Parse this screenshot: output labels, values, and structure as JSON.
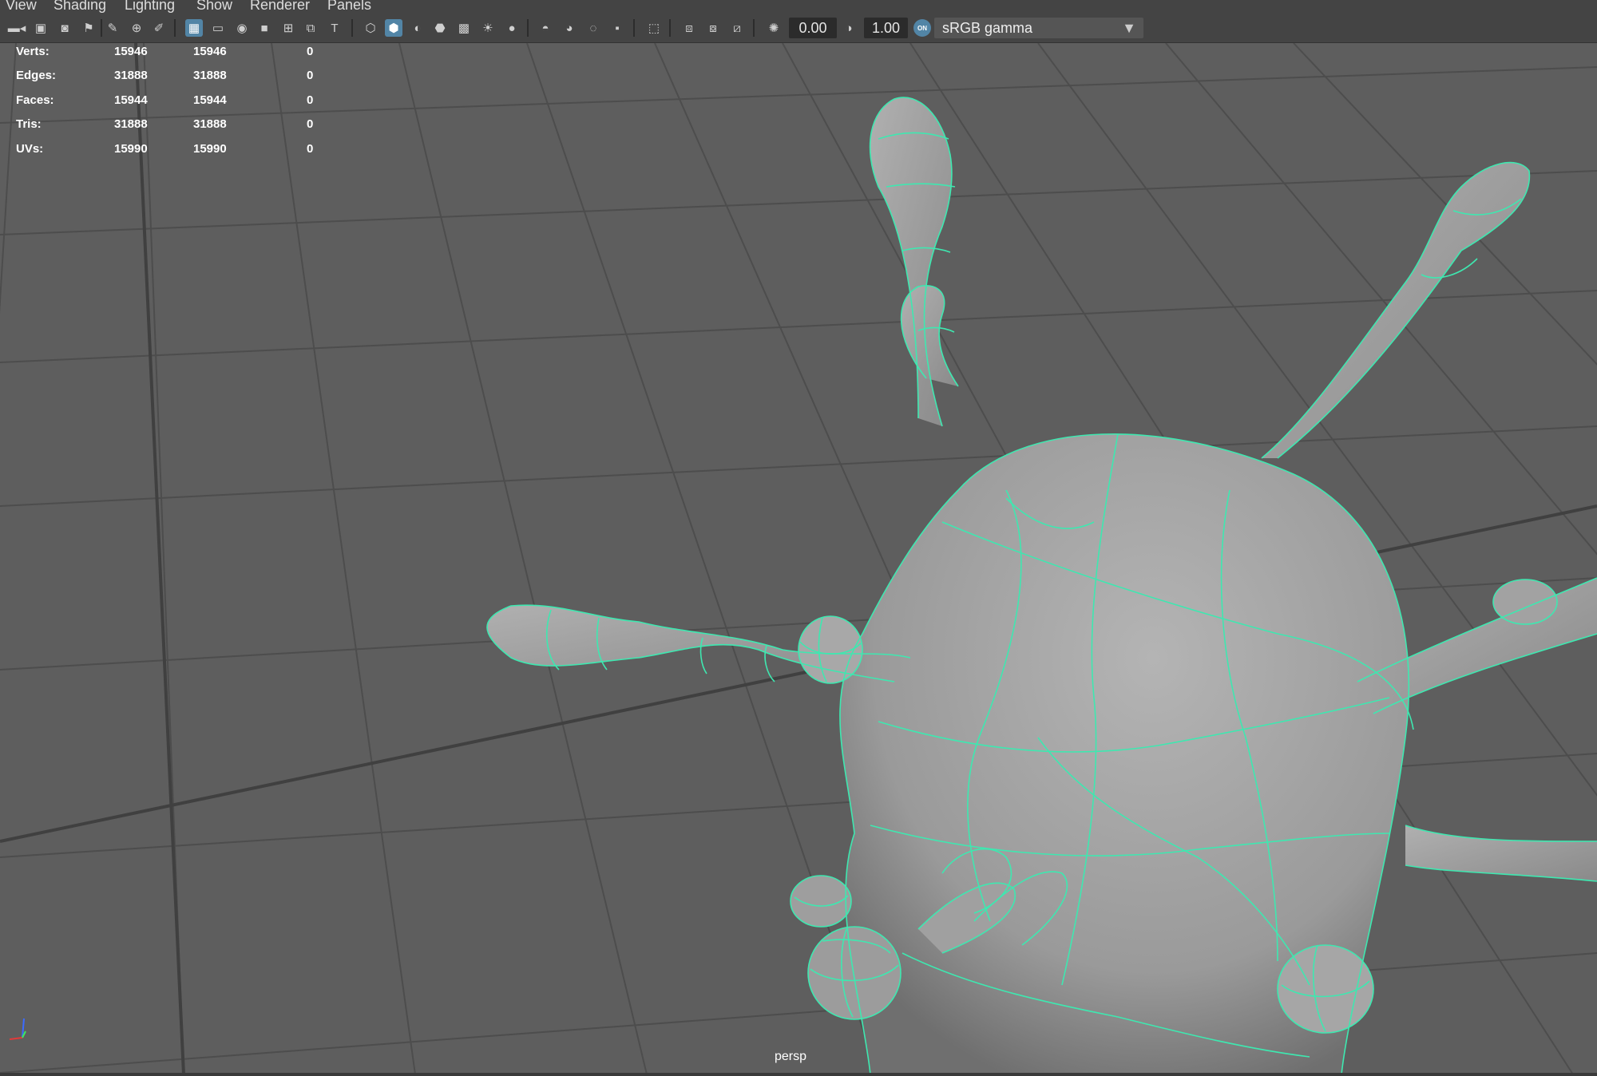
{
  "menus": [
    "View",
    "Shading",
    "Lighting",
    "Show",
    "Renderer",
    "Panels"
  ],
  "toolbar": {
    "exposure_value": "0.00",
    "gamma_value": "1.00",
    "color_management_badge": "ON",
    "color_space": "sRGB gamma",
    "icons": [
      "camera-select-icon",
      "camera-attributes-icon",
      "camera-bookmark-icon",
      "bookmark-icon",
      "image-plane-icon",
      "2d-pan-zoom-icon",
      "grease-pencil-icon",
      "grid-icon",
      "film-gate-icon",
      "resolution-gate-icon",
      "gate-mask-icon",
      "field-chart-icon",
      "safe-action-icon",
      "safe-title-icon",
      "wireframe-icon",
      "smooth-shade-all-icon",
      "use-default-material-icon",
      "wireframe-on-shaded-icon",
      "xray-icon",
      "use-all-lights-icon",
      "shadows-icon",
      "screen-space-ambient-occlusion-icon",
      "motion-blur-icon",
      "multisample-antialiasing-icon",
      "depth-of-field-icon",
      "isolate-select-icon",
      "xray-joints-icon",
      "xray-active-components-icon",
      "backface-culling-icon",
      "exposure-icon",
      "gamma-icon",
      "color-management-icon"
    ]
  },
  "hud": {
    "rows": [
      {
        "label": "Verts:",
        "v1": "15946",
        "v2": "15946",
        "v3": "0"
      },
      {
        "label": "Edges:",
        "v1": "31888",
        "v2": "31888",
        "v3": "0"
      },
      {
        "label": "Faces:",
        "v1": "15944",
        "v2": "15944",
        "v3": "0"
      },
      {
        "label": "Tris:",
        "v1": "31888",
        "v2": "31888",
        "v3": "0"
      },
      {
        "label": "UVs:",
        "v1": "15990",
        "v2": "15990",
        "v3": "0"
      }
    ]
  },
  "viewport": {
    "camera_name": "persp",
    "wireframe_color": "#3ee8b0",
    "mesh_color": "#a3a3a3",
    "background_color": "#5d5d5d",
    "grid_color": "#4a4a4a"
  }
}
